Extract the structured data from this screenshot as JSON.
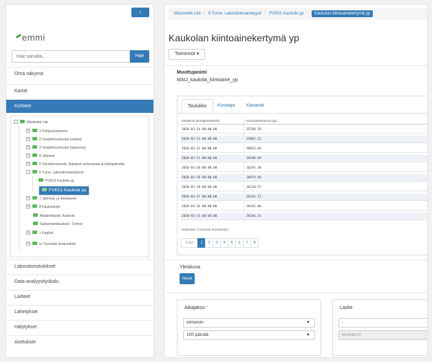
{
  "sidebar": {
    "toggle_glyph": "›",
    "logo": "emmi",
    "search": {
      "placeholder": "Hae sanalla...",
      "button": "Hae"
    },
    "nav_top": [
      "Oma näkymä",
      "Kartat",
      "Kohteet"
    ],
    "nav_bottom": [
      "Laboratoriotulokset",
      "Data-analyysityökalu",
      "Laitteet",
      "Lähetykset",
      "Hälytykset",
      "Asetukset"
    ],
    "tree": [
      "Maskotek Lite",
      "1 Pohjavesiasema",
      "2 Vesijohtoverkosto (vanha)",
      "3 Vesijohtoverkosto (laskuosa)",
      "4 Jätevesi",
      "5 Viemäriverkosto: Näytteet verkostosta ja kärkipaikoilta",
      "6 Turve, Laboratorioanalyysit",
      "PVK01 Kaukola yp",
      "PVK01 Kaukola yp",
      "7 Jätevesi, ja merialueet",
      "8 Kaukolampi",
      "Maakohtaiset, Kaukola",
      "Sadannamittaukset - Kohtot",
      "+ English",
      "xx Torniolan ilmanvaihto"
    ]
  },
  "main": {
    "breadcrumb": [
      "Masinotek Lite",
      "6 Turve, Laboratorioanalyysit",
      "PVK01 Kaukola yp",
      "Kaukolan kiintoainekertymä yp"
    ],
    "title": "Kaukolan kiintoainekertymä yp",
    "actions_button": "Toiminnot ▾",
    "var_label": "Muuttujanimi",
    "var_value": "MAIJ_kaukola_kiintoaine_yp",
    "tabs": [
      "Taulukko",
      "Kuvaaja",
      "Kanavat"
    ],
    "table": {
      "headers": [
        "Aikaleima (Europe/Helsinki)",
        "Kiintoainekertymä (yp)"
      ],
      "rows": [
        [
          "2020-03-24 00:00:00",
          "35708.18"
        ],
        [
          "2020-03-23 00:00:00",
          "35882.22"
        ],
        [
          "2020-03-22 00:00:00",
          "36053.84"
        ],
        [
          "2020-03-21 00:00:00",
          "36198.69"
        ],
        [
          "2020-03-20 00:00:00",
          "36295.38"
        ],
        [
          "2020-03-19 00:00:00",
          "36079.96"
        ],
        [
          "2020-03-18 00:00:00",
          "36118.57"
        ],
        [
          "2020-03-17 00:00:00",
          "36192.71"
        ],
        [
          "2020-03-16 00:00:00",
          "36241.86"
        ],
        [
          "2020-03-15 00:00:00",
          "36184.32"
        ]
      ],
      "summary": "Näytetään 2 kanavaa (9 pöörtetty)"
    },
    "pager": [
      "Edel",
      "1",
      "2",
      "3",
      "4",
      "5",
      "6",
      "7",
      "8"
    ],
    "overview": {
      "label": "Yleiskuva",
      "button": "Näytä"
    },
    "period": {
      "label": "Aikajakso",
      "required": "*",
      "select1": "viimeisin",
      "select2": "100 päivää"
    },
    "calc": {
      "label": "Laske",
      "select1": "-",
      "select2": "keskiarvo"
    }
  }
}
